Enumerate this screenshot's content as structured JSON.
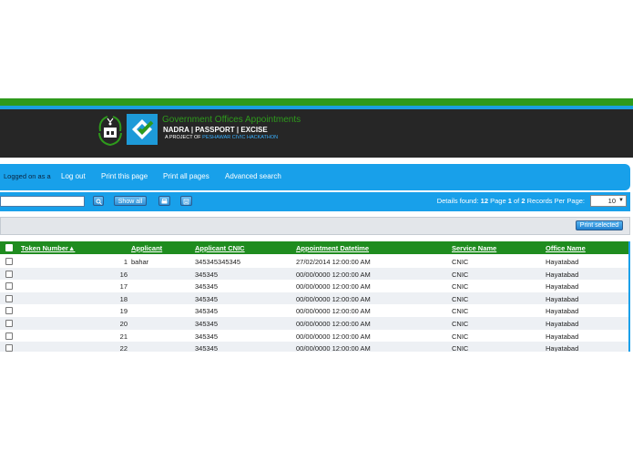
{
  "header": {
    "app_title": "Government Offices Appointments",
    "app_subtitle": "NADRA | PASSPORT | EXCISE",
    "project_prefix": "A PROJECT OF",
    "project_name": "PESHAWAR CIVIC HACKATHON"
  },
  "nav": {
    "status": "Logged on as a",
    "links": [
      "Log out",
      "Print this page",
      "Print all pages",
      "Advanced search"
    ]
  },
  "toolbar": {
    "search_value": "",
    "show_all_label": "Show all",
    "details_label": "Details found:",
    "details_count": "12",
    "page_label": "Page",
    "page_current": "1",
    "page_of": "of",
    "page_total": "2",
    "records_label": "Records Per Page:",
    "records_per_page": "10"
  },
  "results": {
    "print_selected_label": "Print selected"
  },
  "table": {
    "columns": [
      "Token Number",
      "Applicant",
      "Applicant CNIC",
      "Appointment Datetime",
      "Service Name",
      "Office Name"
    ],
    "rows": [
      [
        "1",
        "bahar",
        "345345345345",
        "27/02/2014 12:00:00 AM",
        "CNIC",
        "Hayatabad"
      ],
      [
        "16",
        "",
        "345345",
        "00/00/0000 12:00:00 AM",
        "CNIC",
        "Hayatabad"
      ],
      [
        "17",
        "",
        "345345",
        "00/00/0000 12:00:00 AM",
        "CNIC",
        "Hayatabad"
      ],
      [
        "18",
        "",
        "345345",
        "00/00/0000 12:00:00 AM",
        "CNIC",
        "Hayatabad"
      ],
      [
        "19",
        "",
        "345345",
        "00/00/0000 12:00:00 AM",
        "CNIC",
        "Hayatabad"
      ],
      [
        "20",
        "",
        "345345",
        "00/00/0000 12:00:00 AM",
        "CNIC",
        "Hayatabad"
      ],
      [
        "21",
        "",
        "345345",
        "00/00/0000 12:00:00 AM",
        "CNIC",
        "Hayatabad"
      ],
      [
        "22",
        "",
        "345345",
        "00/00/0000 12:00:00 AM",
        "CNIC",
        "Hayatabad"
      ]
    ]
  },
  "colors": {
    "accent_blue": "#18a0ea",
    "brand_green": "#2e9a1c",
    "header_dark": "#262626"
  },
  "icons": {
    "search": "magnifier-icon",
    "print": "printer-icon",
    "export": "export-icon",
    "sort": "sort-ascending-icon"
  }
}
